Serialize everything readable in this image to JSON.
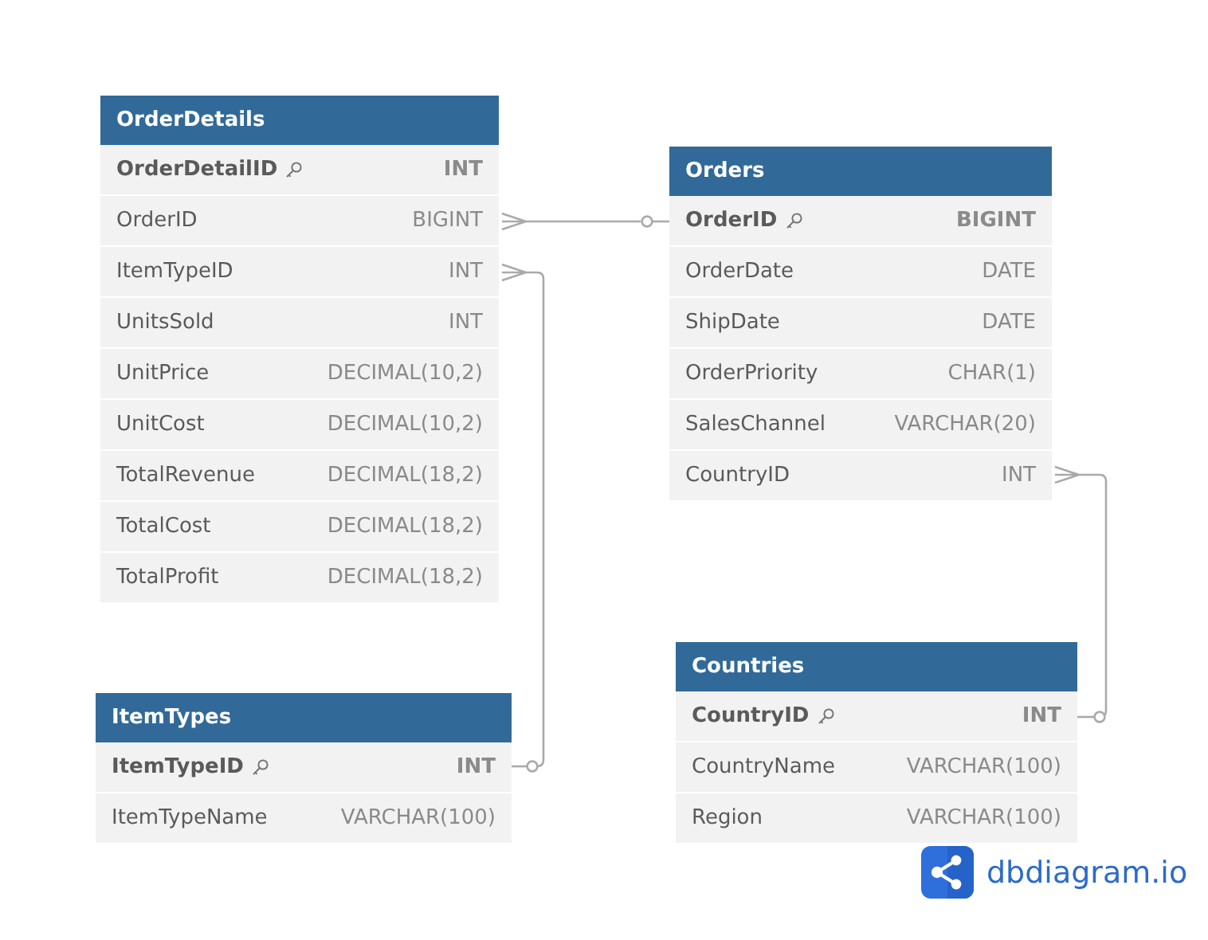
{
  "tables": [
    {
      "name": "OrderDetails",
      "fields": [
        {
          "name": "OrderDetailID",
          "type": "INT",
          "primary_key": true
        },
        {
          "name": "OrderID",
          "type": "BIGINT",
          "primary_key": false
        },
        {
          "name": "ItemTypeID",
          "type": "INT",
          "primary_key": false
        },
        {
          "name": "UnitsSold",
          "type": "INT",
          "primary_key": false
        },
        {
          "name": "UnitPrice",
          "type": "DECIMAL(10,2)",
          "primary_key": false
        },
        {
          "name": "UnitCost",
          "type": "DECIMAL(10,2)",
          "primary_key": false
        },
        {
          "name": "TotalRevenue",
          "type": "DECIMAL(18,2)",
          "primary_key": false
        },
        {
          "name": "TotalCost",
          "type": "DECIMAL(18,2)",
          "primary_key": false
        },
        {
          "name": "TotalProfit",
          "type": "DECIMAL(18,2)",
          "primary_key": false
        }
      ]
    },
    {
      "name": "Orders",
      "fields": [
        {
          "name": "OrderID",
          "type": "BIGINT",
          "primary_key": true
        },
        {
          "name": "OrderDate",
          "type": "DATE",
          "primary_key": false
        },
        {
          "name": "ShipDate",
          "type": "DATE",
          "primary_key": false
        },
        {
          "name": "OrderPriority",
          "type": "CHAR(1)",
          "primary_key": false
        },
        {
          "name": "SalesChannel",
          "type": "VARCHAR(20)",
          "primary_key": false
        },
        {
          "name": "CountryID",
          "type": "INT",
          "primary_key": false
        }
      ]
    },
    {
      "name": "ItemTypes",
      "fields": [
        {
          "name": "ItemTypeID",
          "type": "INT",
          "primary_key": true
        },
        {
          "name": "ItemTypeName",
          "type": "VARCHAR(100)",
          "primary_key": false
        }
      ]
    },
    {
      "name": "Countries",
      "fields": [
        {
          "name": "CountryID",
          "type": "INT",
          "primary_key": true
        },
        {
          "name": "CountryName",
          "type": "VARCHAR(100)",
          "primary_key": false
        },
        {
          "name": "Region",
          "type": "VARCHAR(100)",
          "primary_key": false
        }
      ]
    }
  ],
  "brand": "dbdiagram.io"
}
